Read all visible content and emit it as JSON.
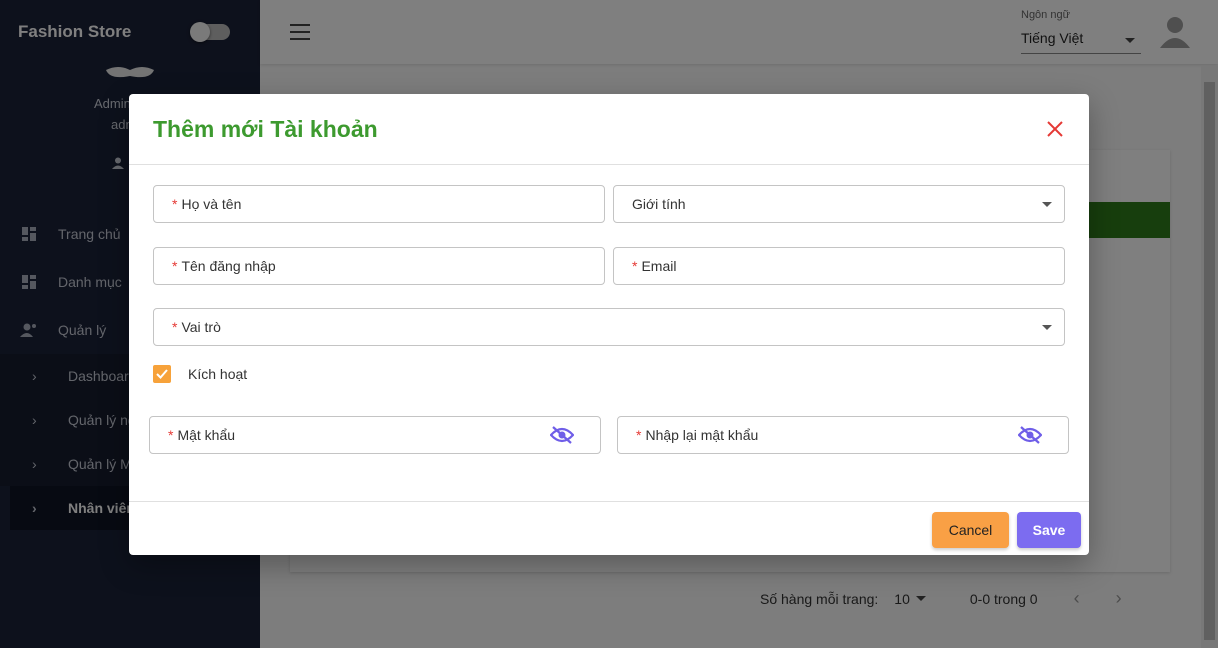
{
  "sidebar": {
    "brand": "Fashion Store",
    "profile": {
      "name": "Admin",
      "username": "admin"
    },
    "items": [
      {
        "label": "Trang chủ"
      },
      {
        "label": "Danh mục"
      },
      {
        "label": "Quản lý"
      }
    ],
    "sub_items": [
      {
        "label": "Dashboard"
      },
      {
        "label": "Quản lý người dùng"
      },
      {
        "label": "Quản lý Màu sắc"
      },
      {
        "label": "Nhân viên"
      }
    ]
  },
  "topbar": {
    "language_label": "Ngôn ngữ",
    "language_value": "Tiếng Việt"
  },
  "pagination": {
    "rows_label": "Số hàng mỗi trang:",
    "rows_value": "10",
    "range": "0-0 trong 0"
  },
  "modal": {
    "title": "Thêm mới Tài khoản",
    "fields": {
      "full_name": {
        "label": "Họ và tên",
        "required": "*"
      },
      "gender": {
        "label": "Giới tính"
      },
      "username": {
        "label": "Tên đăng nhập",
        "required": "*"
      },
      "email": {
        "label": "Email",
        "required": "*"
      },
      "role": {
        "label": "Vai trò",
        "required": "*"
      },
      "password": {
        "label": "Mật khẩu",
        "required": "*"
      },
      "confirm_password": {
        "label": "Nhập lại mật khẩu",
        "required": "*"
      }
    },
    "active_label": "Kích hoạt",
    "cancel_label": "Cancel",
    "save_label": "Save"
  },
  "colors": {
    "title": "#3d9a2f",
    "close": "#e53935",
    "checkbox": "#f7a23a",
    "cancel": "#f9a045",
    "save": "#7c6cf0",
    "eye": "#6f5ee8",
    "sidebar": "#1b2238"
  }
}
